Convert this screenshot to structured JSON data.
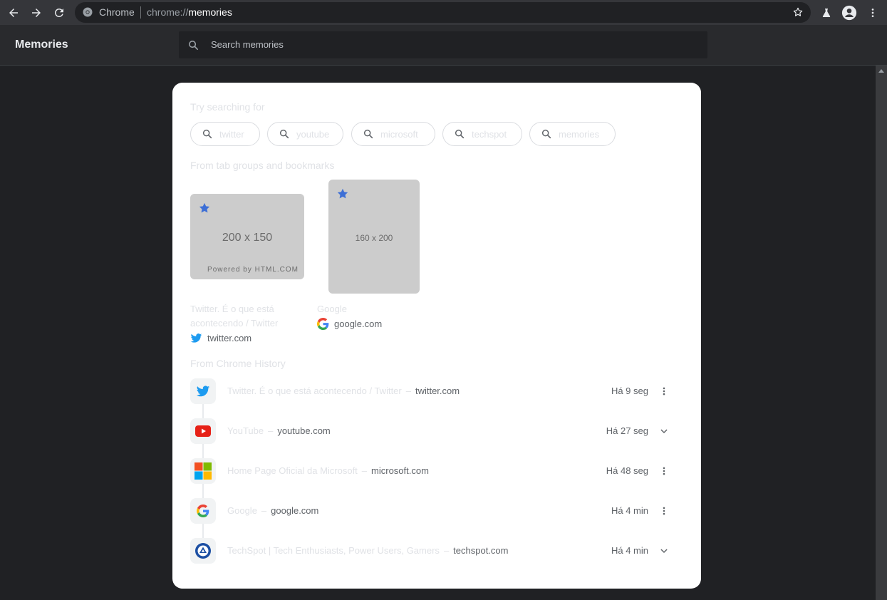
{
  "browser": {
    "omnibox_site": "Chrome",
    "omnibox_scheme": "chrome://",
    "omnibox_path": "memories"
  },
  "app": {
    "title": "Memories",
    "search_placeholder": "Search memories"
  },
  "suggestions": {
    "heading": "Try searching for",
    "chips": [
      "twitter",
      "youtube",
      "microsoft",
      "techspot",
      "memories"
    ]
  },
  "bookmarks": {
    "heading": "From tab groups and bookmarks",
    "tiles": [
      {
        "thumb_text": "200 x 150",
        "thumb_sub": "Powered by HTML.COM",
        "title_line1": "Twitter. É o que está",
        "title_line2": "acontecendo / Twitter",
        "url": "twitter.com",
        "favicon": "twitter-icon"
      },
      {
        "thumb_text": "160 x 200",
        "title_line1": "Google",
        "url": "google.com",
        "favicon": "google-icon"
      }
    ]
  },
  "history": {
    "heading": "From Chrome History",
    "items": [
      {
        "title": "Twitter. É o que está acontecendo / Twitter",
        "host": "twitter.com",
        "time": "Há 9 seg",
        "favicon": "twitter-icon",
        "action": "more-vert-icon"
      },
      {
        "title": "YouTube",
        "host": "youtube.com",
        "time": "Há 27 seg",
        "favicon": "youtube-icon",
        "action": "chevron-down-icon"
      },
      {
        "title": "Home Page Oficial da Microsoft",
        "host": "microsoft.com",
        "time": "Há 48 seg",
        "favicon": "microsoft-icon",
        "action": "more-vert-icon"
      },
      {
        "title": "Google",
        "host": "google.com",
        "time": "Há 4 min",
        "favicon": "google-icon",
        "action": "more-vert-icon"
      },
      {
        "title": "TechSpot | Tech Enthusiasts, Power Users, Gamers",
        "host": "techspot.com",
        "time": "Há 4 min",
        "favicon": "techspot-icon",
        "action": "chevron-down-icon"
      }
    ]
  },
  "colors": {
    "toolbar": "#35363a",
    "page_background": "#202124",
    "card": "#ffffff",
    "bookmark_star": "#3d6fd6"
  }
}
